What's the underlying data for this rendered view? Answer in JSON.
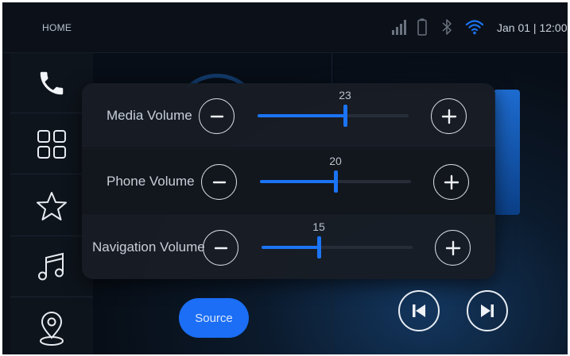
{
  "status_bar": {
    "home_label": "HOME",
    "clock": "Jan 01 | 12:00",
    "icons": [
      "signal-icon",
      "battery-icon",
      "bluetooth-icon",
      "wifi-icon"
    ],
    "wifi_color": "#1b74f5"
  },
  "sidebar": {
    "items": [
      {
        "icon": "phone-icon"
      },
      {
        "icon": "apps-grid-icon"
      },
      {
        "icon": "star-icon"
      },
      {
        "icon": "music-icon"
      },
      {
        "icon": "location-icon"
      }
    ]
  },
  "volume_panel": {
    "rows": [
      {
        "label": "Media Volume",
        "value": "23",
        "level": 0.58
      },
      {
        "label": "Phone Volume",
        "value": "20",
        "level": 0.5
      },
      {
        "label": "Navigation Volume",
        "value": "15",
        "level": 0.38
      }
    ]
  },
  "media": {
    "source_label": "Source",
    "controls": [
      "previous-icon",
      "next-icon"
    ]
  },
  "colors": {
    "accent": "#1b74f5",
    "background": "#0b1018"
  }
}
